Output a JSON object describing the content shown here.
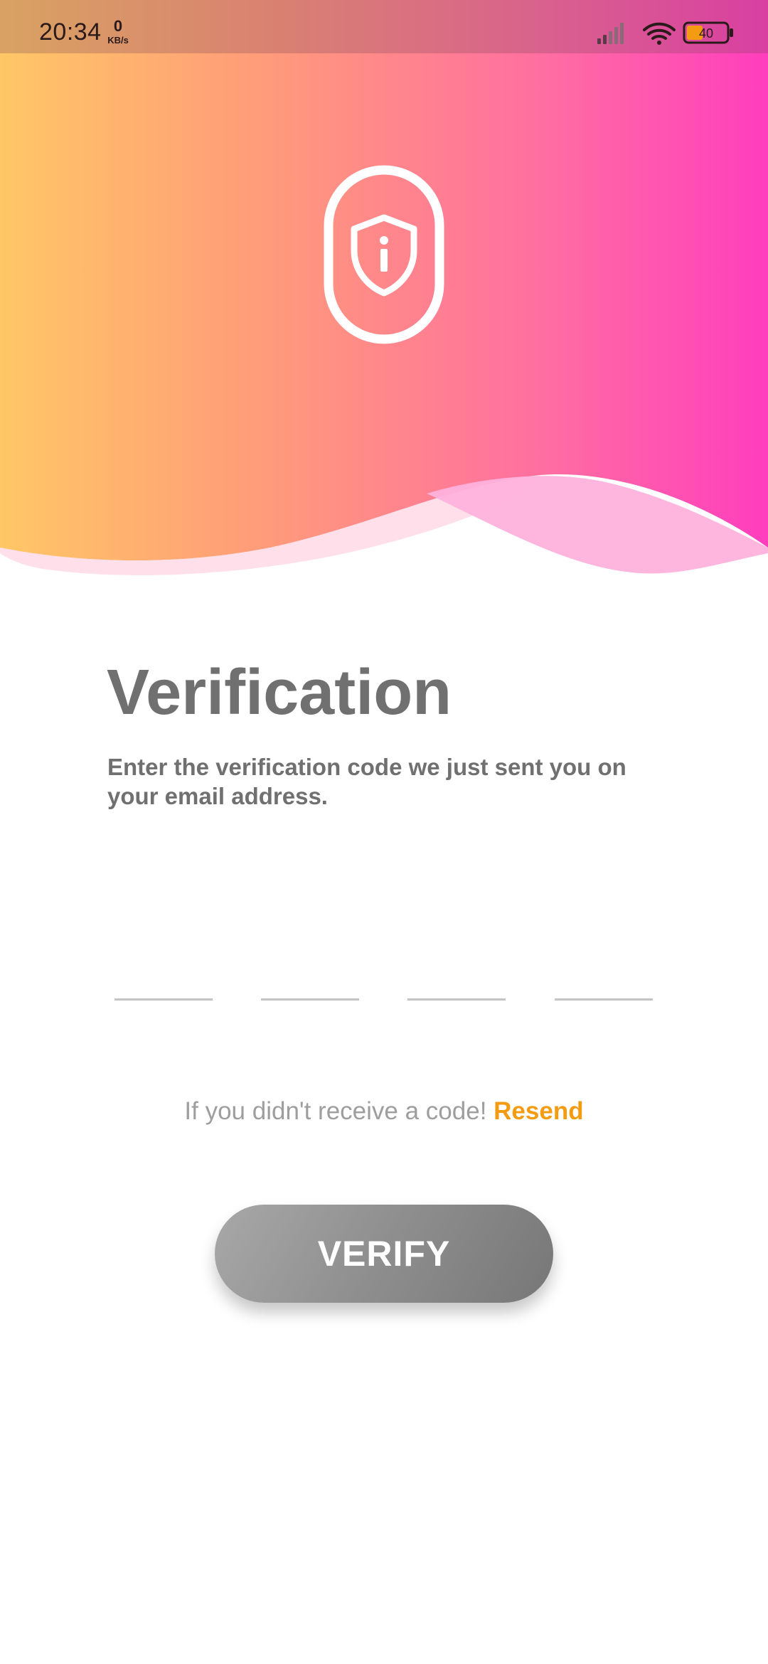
{
  "status_bar": {
    "time": "20:34",
    "speed_value": "0",
    "speed_unit": "KB/s",
    "battery_level": "40",
    "icons": [
      "signal-icon",
      "wifi-icon",
      "battery-icon"
    ]
  },
  "hero": {
    "icon": "phone-shield-info-icon",
    "gradient_colors": [
      "#FFC766",
      "#FF9A7A",
      "#FF6FA0",
      "#FF3EBE"
    ]
  },
  "verification": {
    "title": "Verification",
    "subtitle": "Enter the verification code we just sent you on your email address.",
    "code_digits": [
      {
        "value": "",
        "placeholder": ""
      },
      {
        "value": "",
        "placeholder": ""
      },
      {
        "value": "",
        "placeholder": ""
      },
      {
        "value": "",
        "placeholder": ""
      }
    ],
    "resend_prompt": "If you didn't receive a code! ",
    "resend_label": "Resend",
    "verify_label": "VERIFY"
  },
  "colors": {
    "accent": "#F39C12",
    "text_primary": "#707070",
    "text_muted": "#9E9E9E",
    "button": "#8E8E8E"
  }
}
